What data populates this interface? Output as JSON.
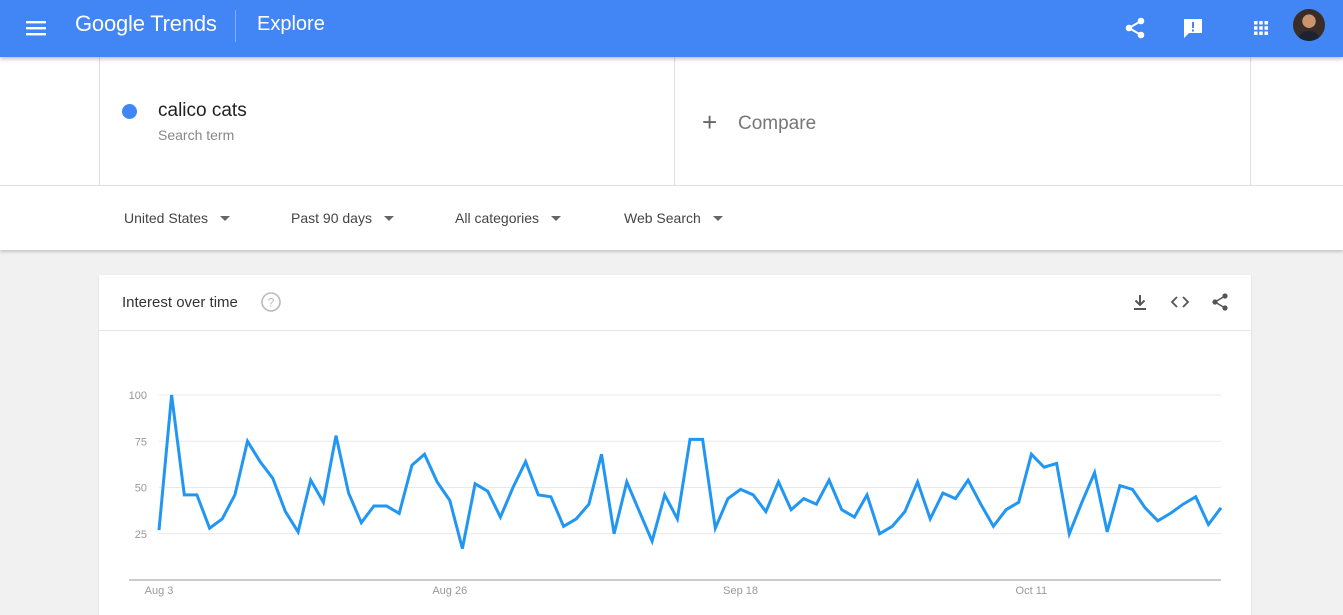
{
  "header": {
    "logo_text": "Google Trends",
    "page_title": "Explore",
    "accent_color": "#4285f4",
    "icons": [
      "menu-icon",
      "share-icon",
      "feedback-icon",
      "apps-icon",
      "avatar"
    ]
  },
  "search_terms": [
    {
      "term": "calico cats",
      "subtitle": "Search term",
      "color": "#4285f4"
    }
  ],
  "compare": {
    "label": "Compare"
  },
  "filters": {
    "region": "United States",
    "time_range": "Past 90 days",
    "category": "All categories",
    "search_type": "Web Search"
  },
  "interest_card": {
    "title": "Interest over time",
    "icons": [
      "help-icon",
      "download-icon",
      "embed-icon",
      "share-icon"
    ]
  },
  "chart_data": {
    "type": "line",
    "title": "",
    "xlabel": "",
    "ylabel": "",
    "ylim": [
      0,
      100
    ],
    "y_ticks": [
      25,
      50,
      75,
      100
    ],
    "x_tick_labels": [
      "Aug 3",
      "Aug 26",
      "Sep 18",
      "Oct 11"
    ],
    "x_tick_index": [
      0,
      23,
      46,
      69
    ],
    "grid": true,
    "series": [
      {
        "color": "#2196f3",
        "values": [
          27,
          100,
          46,
          46,
          28,
          33,
          46,
          75,
          64,
          55,
          37,
          26,
          54,
          42,
          78,
          47,
          31,
          40,
          40,
          36,
          62,
          68,
          53,
          43,
          17,
          52,
          48,
          34,
          50,
          64,
          46,
          45,
          29,
          33,
          41,
          68,
          25,
          53,
          37,
          21,
          46,
          33,
          76,
          76,
          28,
          44,
          49,
          46,
          37,
          53,
          38,
          44,
          41,
          54,
          38,
          34,
          46,
          25,
          29,
          37,
          53,
          33,
          47,
          44,
          54,
          41,
          29,
          38,
          42,
          68,
          61,
          63,
          25,
          42,
          58,
          26,
          51,
          49,
          39,
          32,
          36,
          41,
          45,
          30,
          39
        ]
      }
    ]
  }
}
